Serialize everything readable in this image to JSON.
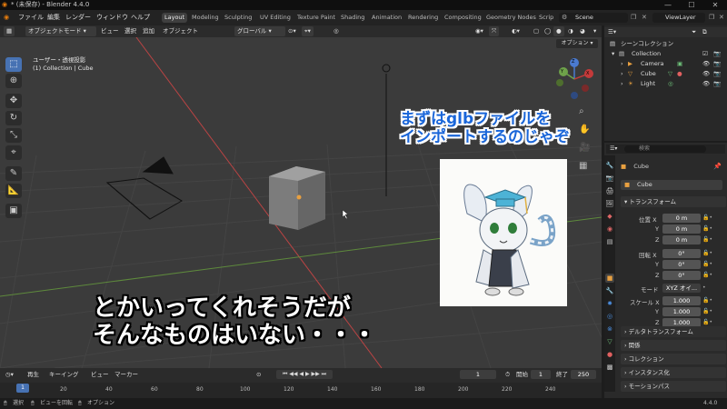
{
  "titlebar": {
    "title": "* (未保存) - Blender 4.4.0",
    "minimize": "—",
    "maximize": "☐",
    "close": "✕"
  },
  "menubar": {
    "items": [
      "ファイル",
      "編集",
      "レンダー",
      "ウィンドウ",
      "ヘルプ"
    ],
    "workspaces": [
      "Layout",
      "Modeling",
      "Sculpting",
      "UV Editing",
      "Texture Paint",
      "Shading",
      "Animation",
      "Rendering",
      "Compositing",
      "Geometry Nodes",
      "Scrip"
    ],
    "scene": "Scene",
    "viewlayer": "ViewLayer"
  },
  "header": {
    "mode": "オブジェクトモード",
    "menus": [
      "ビュー",
      "選択",
      "追加",
      "オブジェクト"
    ],
    "orientation": "グローバル",
    "options": "オプション"
  },
  "viewport": {
    "view_name": "ユーザー・透視投影",
    "collection_info": "(1) Collection | Cube",
    "gizmo": {
      "x": "X",
      "y": "Y",
      "z": "Z"
    }
  },
  "captions": {
    "blue_line1": "まずはglbファイルを",
    "blue_line2": "インポートするのじゃぞ",
    "white_line1": "とかいってくれそうだが",
    "white_line2": "そんなものはいない・・・"
  },
  "outliner": {
    "title": "シーンコレクション",
    "items": [
      {
        "label": "Collection"
      },
      {
        "label": "Camera"
      },
      {
        "label": "Cube"
      },
      {
        "label": "Light"
      }
    ]
  },
  "properties": {
    "search_placeholder": "検索",
    "object_name": "Cube",
    "object_field": "Cube",
    "transform": {
      "title": "トランスフォーム",
      "location_label": "位置 X",
      "y": "Y",
      "z": "Z",
      "location": [
        "0 m",
        "0 m",
        "0 m"
      ],
      "rotation_label": "回転 X",
      "rotation": [
        "0°",
        "0°",
        "0°"
      ],
      "mode_label": "モード",
      "mode_value": "XYZ オイ...",
      "scale_label": "スケール X",
      "scale": [
        "1.000",
        "1.000",
        "1.000"
      ]
    },
    "sections": [
      "デルタトランスフォーム",
      "関係",
      "コレクション",
      "インスタンス化",
      "モーションパス"
    ]
  },
  "timeline": {
    "menus": [
      "再生",
      "キーイング",
      "ビュー",
      "マーカー"
    ],
    "current_frame": "1",
    "start_label": "開始",
    "start": "1",
    "end_label": "終了",
    "end": "250",
    "ruler": [
      "1",
      "20",
      "40",
      "60",
      "80",
      "100",
      "120",
      "140",
      "160",
      "180",
      "200",
      "220",
      "240"
    ]
  },
  "statusbar": {
    "hint1": "選択",
    "hint2": "ビューを回転",
    "hint3": "オプション",
    "version": "4.4.0"
  },
  "colors": {
    "accent": "#4772b3",
    "caption_blue": "#1565d8",
    "viewport_bg": "#3b3b3b",
    "x_axis": "#c43a3a",
    "y_axis": "#6ea24a"
  }
}
